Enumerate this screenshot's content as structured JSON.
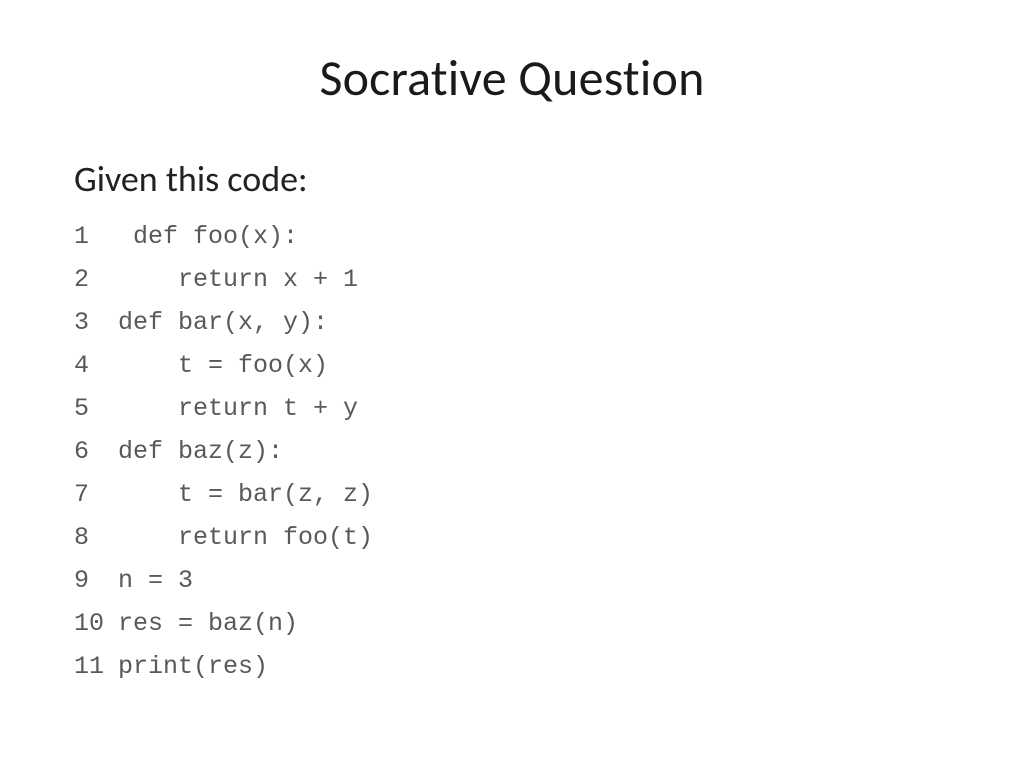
{
  "slide": {
    "title": "Socrative Question",
    "prompt": "Given this code:",
    "code": [
      {
        "num": "1",
        "text": " def foo(x):"
      },
      {
        "num": "2",
        "text": "    return x + 1"
      },
      {
        "num": "3",
        "text": "def bar(x, y):"
      },
      {
        "num": "4",
        "text": "    t = foo(x)"
      },
      {
        "num": "5",
        "text": "    return t + y"
      },
      {
        "num": "6",
        "text": "def baz(z):"
      },
      {
        "num": "7",
        "text": "    t = bar(z, z)"
      },
      {
        "num": "8",
        "text": "    return foo(t)"
      },
      {
        "num": "9",
        "text": "n = 3"
      },
      {
        "num": "10",
        "text": "res = baz(n)"
      },
      {
        "num": "11",
        "text": "print(res)"
      }
    ]
  }
}
